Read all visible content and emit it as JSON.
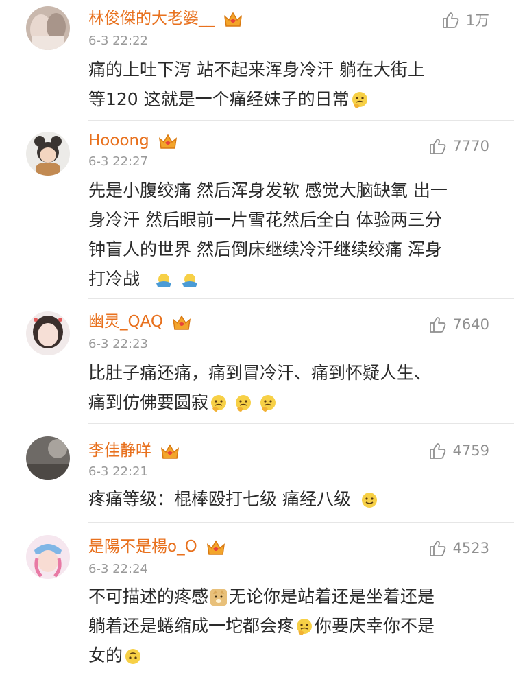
{
  "comments": [
    {
      "username": "林俊傑的大老婆__",
      "time": "6-3 22:22",
      "likes": "1万",
      "text_lines": [
        "痛的上吐下泻  站不起来浑身冷汗  躺在大街上",
        "等120  这就是一个痛经妹子的日常"
      ],
      "avatar": "avatar-hands"
    },
    {
      "username": "Hooong",
      "time": "6-3 22:27",
      "likes": "7770",
      "text_lines": [
        "先是小腹绞痛 然后浑身发软 感觉大脑缺氧 出一",
        "身冷汗 然后眼前一片雪花然后全白 体验两三分",
        "钟盲人的世界 然后倒床继续冷汗继续绞痛 浑身",
        "打冷战"
      ],
      "avatar": "avatar-child"
    },
    {
      "username": "幽灵_QAQ",
      "time": "6-3 22:23",
      "likes": "7640",
      "text_lines": [
        "比肚子痛还痛，痛到冒冷汗、痛到怀疑人生、",
        "痛到仿佛要圆寂"
      ],
      "avatar": "avatar-girl"
    },
    {
      "username": "李佳静咩",
      "time": "6-3 22:21",
      "likes": "4759",
      "text_lines": [
        "疼痛等级：棍棒殴打七级 痛经八级"
      ],
      "avatar": "avatar-gray"
    },
    {
      "username": "是陽不是楊o_O",
      "time": "6-3 22:24",
      "likes": "4523",
      "text_lines": [
        "不可描述的疼感",
        "无论你是站着还是坐着还是",
        "躺着还是蜷缩成一坨都会疼",
        "你要庆幸你不是",
        "女的"
      ],
      "avatar": "avatar-anime"
    }
  ],
  "colors": {
    "username": "#e8711e",
    "time": "#9a9a9a",
    "text": "#2a2a2a",
    "likes": "#8f8f8f"
  }
}
